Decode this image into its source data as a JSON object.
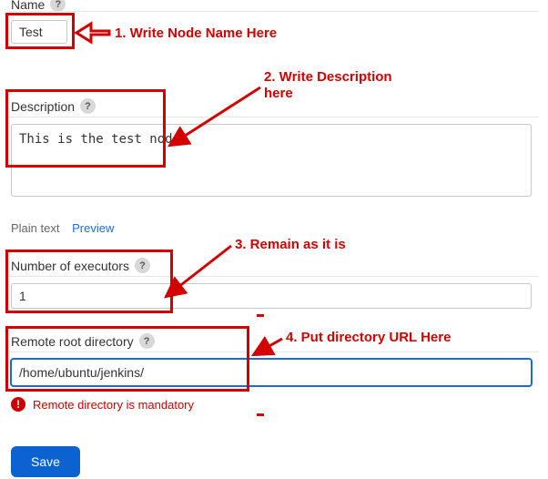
{
  "nameField": {
    "label": "Name",
    "value": "Test"
  },
  "description": {
    "label": "Description",
    "value": "This is the test node."
  },
  "tabs": {
    "plain": "Plain text",
    "preview": "Preview"
  },
  "executors": {
    "label": "Number of executors",
    "value": "1"
  },
  "remoteRoot": {
    "label": "Remote root directory",
    "value": "/home/ubuntu/jenkins/"
  },
  "error": {
    "text": "Remote directory is mandatory"
  },
  "buttons": {
    "save": "Save"
  },
  "help": {
    "glyph": "?"
  },
  "annotations": {
    "a1": "1. Write Node Name Here",
    "a2_l1": "2. Write Description",
    "a2_l2": "here",
    "a3": "3. Remain as it is",
    "a4": "4. Put directory URL Here"
  }
}
